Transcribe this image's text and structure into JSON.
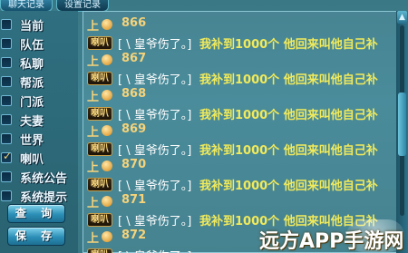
{
  "tabs": [
    "聊天记录",
    "设置记录"
  ],
  "channels": [
    {
      "label": "当前",
      "checked": false
    },
    {
      "label": "队伍",
      "checked": false
    },
    {
      "label": "私聊",
      "checked": false
    },
    {
      "label": "帮派",
      "checked": false
    },
    {
      "label": "门派",
      "checked": false
    },
    {
      "label": "夫妻",
      "checked": false
    },
    {
      "label": "世界",
      "checked": false
    },
    {
      "label": "喇叭",
      "checked": true
    },
    {
      "label": "系统公告",
      "checked": false
    },
    {
      "label": "系统提示",
      "checked": false
    }
  ],
  "buttons": {
    "query": "查 询",
    "save": "保 存"
  },
  "chat": {
    "up_label": "上",
    "badge": "喇叭",
    "bracket_text": "[ \\ 皇爷伤了。]",
    "message": "我补到1000个 他回来叫他自己补",
    "counts": [
      "866",
      "867",
      "868",
      "869",
      "870",
      "871",
      "872"
    ]
  },
  "scrollbar": {
    "up": "▲"
  },
  "watermark": {
    "text": "远方APP手游网"
  }
}
